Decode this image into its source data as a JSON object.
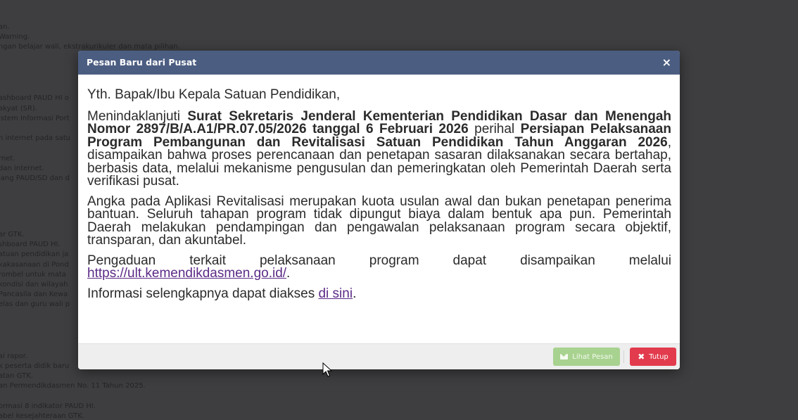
{
  "background": {
    "lines": [
      "an.",
      "Warning.",
      "ngan belajar wali, ekstrakurikuler dan mata pilihan.",
      "ashboard PAUD HI o",
      "akyat (SR).",
      "istem Informasi Port",
      "n internet pada satu",
      "rnet.",
      "dan internet.",
      "jang PAUD/SD dan d",
      "ar GTK.",
      "shboard PAUD HI.",
      "atuan pendidikan ja",
      "kakasanaan di Pond",
      "rombel untuk mata",
      "kondisi dan wilayah",
      "Pancasila dan Kewa",
      "elas dan guru wali p",
      "ai rapor.",
      "k peserta didik baru",
      "atan GTK.",
      "an Permendikdasmen No. 11 Tahun 2025.",
      "ormasi 8 indikator PAUD HI.",
      "abel kesejahteraan GTK."
    ]
  },
  "modal": {
    "title": "Pesan Baru dari Pusat",
    "close_symbol": "×",
    "greeting": "Yth. Bapak/Ibu Kepala Satuan Pendidikan,",
    "p1": {
      "a": "Menindaklanjuti ",
      "b": "Surat Sekretaris Jenderal Kementerian Pendidikan Dasar dan Menengah Nomor 2897/B/A.A1/PR.07.05/2026 tanggal 6 Februari 2026",
      "c": " perihal ",
      "d": "Persiapan Pelaksanaan Program Pembangunan dan Revitalisasi Satuan Pendidikan Tahun Anggaran 2026",
      "e": ", disampaikan bahwa proses perencanaan dan penetapan sasaran dilaksanakan secara bertahap, berbasis data, melalui mekanisme pengusulan dan pemeringkatan oleh Pemerintah Daerah serta verifikasi pusat."
    },
    "p2": "Angka pada Aplikasi Revitalisasi merupakan kuota usulan awal dan bukan penetapan penerima bantuan. Seluruh tahapan program tidak dipungut biaya dalam bentuk apa pun. Pemerintah Daerah melakukan pendampingan dan pengawalan pelaksanaan program secara objektif, transparan, dan akuntabel.",
    "p3": {
      "a": "Pengaduan terkait pelaksanaan program dapat disampaikan melalui ",
      "link": "https://ult.kemendikdasmen.go.id/",
      "b": "."
    },
    "p4": {
      "a": "Informasi selengkapnya dapat diakses ",
      "link": "di sini",
      "b": "."
    },
    "buttons": {
      "view_label": "Lihat Pesan",
      "close_label": "Tutup",
      "close_symbol": "✖"
    }
  },
  "colors": {
    "header": "#4b5d81",
    "view_button": "#a8d28f",
    "close_button": "#e23b4d",
    "link": "#5b2a86"
  }
}
